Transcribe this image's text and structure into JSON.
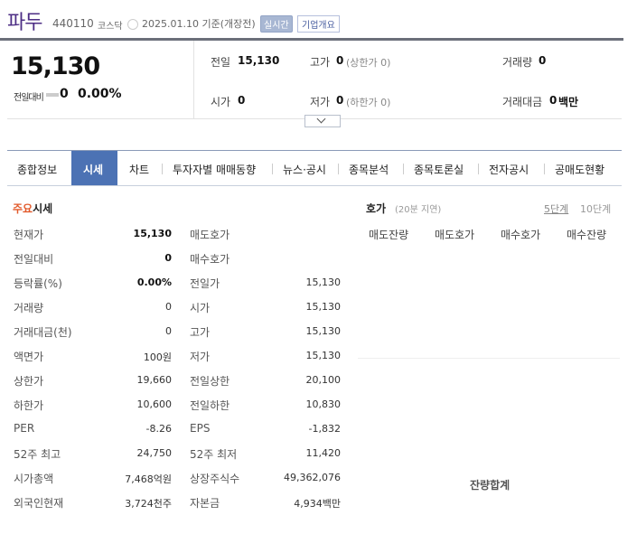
{
  "header": {
    "name": "파두",
    "code": "440110",
    "market": "코스닥",
    "date_basis": "2025.01.10  기준(개장전)",
    "realtime": "실시간",
    "overview": "기업개요"
  },
  "summary": {
    "price": "15,130",
    "change_label": "전일대비",
    "change_value": "0",
    "change_rate": "0.00%",
    "quote": {
      "prev_label": "전일",
      "prev_value": "15,130",
      "high_label": "고가",
      "high_value": "0",
      "upper_limit": "(상한가 0)",
      "volume_label": "거래량",
      "volume_value": "0",
      "open_label": "시가",
      "open_value": "0",
      "low_label": "저가",
      "low_value": "0",
      "lower_limit": "(하한가 0)",
      "amount_label": "거래대금",
      "amount_value": "0",
      "amount_unit": "백만"
    }
  },
  "tabs": [
    "종합정보",
    "시세",
    "차트",
    "투자자별 매매동향",
    "뉴스·공시",
    "종목분석",
    "종목토론실",
    "전자공시",
    "공매도현황"
  ],
  "main": {
    "title_accent": "주요",
    "title_rest": "시세",
    "left_rows": [
      {
        "label": "현재가",
        "value": "15,130"
      },
      {
        "label": "전일대비",
        "value": "0"
      },
      {
        "label": "등락률(%)",
        "value": "0.00%"
      },
      {
        "label": "거래량",
        "value": "0"
      },
      {
        "label": "거래대금(천)",
        "value": "0"
      },
      {
        "label": "액면가",
        "value": "100원"
      },
      {
        "label": "상한가",
        "value": "19,660"
      },
      {
        "label": "하한가",
        "value": "10,600"
      },
      {
        "label": "PER",
        "value": "-8.26"
      },
      {
        "label": "52주 최고",
        "value": "24,750"
      },
      {
        "label": "시가총액",
        "value": "7,468억원"
      },
      {
        "label": "외국인현재",
        "value": "3,724천주"
      }
    ],
    "right_rows": [
      {
        "label": "매도호가",
        "value": ""
      },
      {
        "label": "매수호가",
        "value": ""
      },
      {
        "label": "전일가",
        "value": "15,130"
      },
      {
        "label": "시가",
        "value": "15,130"
      },
      {
        "label": "고가",
        "value": "15,130"
      },
      {
        "label": "저가",
        "value": "15,130"
      },
      {
        "label": "전일상한",
        "value": "20,100"
      },
      {
        "label": "전일하한",
        "value": "10,830"
      },
      {
        "label": "EPS",
        "value": "-1,832"
      },
      {
        "label": "52주 최저",
        "value": "11,420"
      },
      {
        "label": "상장주식수",
        "value": "49,362,076"
      },
      {
        "label": "자본금",
        "value": "4,934백만"
      }
    ]
  },
  "orderbook": {
    "title": "호가",
    "delay": "(20분 지연)",
    "five": "5단계",
    "ten": "10단계",
    "columns": [
      "매도잔량",
      "매도호가",
      "매수호가",
      "매수잔량"
    ],
    "total": "잔량합계"
  }
}
